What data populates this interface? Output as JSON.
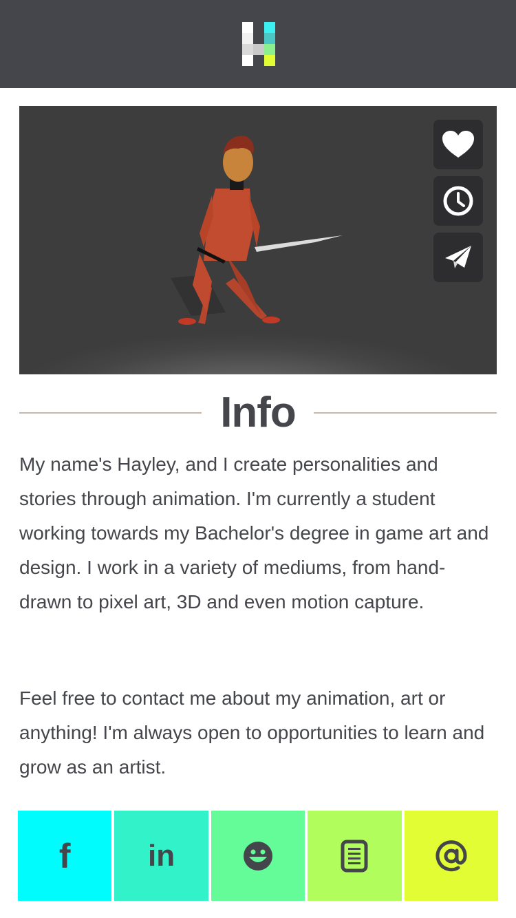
{
  "header": {
    "logo_icon": "pixel-h-logo-icon",
    "logo_colors": [
      "#ffffff",
      "#d9d9d9",
      "#3cf0f2",
      "#8cf08e",
      "#e2fd34"
    ]
  },
  "hero": {
    "image": "animated-character-with-sword",
    "actions": [
      {
        "icon": "heart-icon"
      },
      {
        "icon": "clock-icon"
      },
      {
        "icon": "paper-plane-icon"
      }
    ]
  },
  "info": {
    "title": "Info",
    "paragraph1": "My name's Hayley, and I create personalities and stories through animation. I'm currently a student working towards my Bachelor's degree in game art and design. I work in a variety of mediums, from hand-drawn to pixel art, 3D and even motion capture.",
    "paragraph2": "Feel free to contact me about my animation, art or anything! I'm always open to opportunities to learn and grow as an artist."
  },
  "social": {
    "facebook_glyph": "f",
    "linkedin_glyph": "in",
    "items": [
      {
        "icon": "facebook-icon",
        "color": "#00fcfd"
      },
      {
        "icon": "linkedin-icon",
        "color": "#31f2c9"
      },
      {
        "icon": "smiley-icon",
        "color": "#63fc98"
      },
      {
        "icon": "document-icon",
        "color": "#b0fd5c"
      },
      {
        "icon": "at-sign-icon",
        "color": "#e2fd34"
      }
    ]
  },
  "colors": {
    "header_bg": "#45464b",
    "text": "#45464b",
    "rule": "#c8b8ab",
    "action_bg": "#2d2d2f"
  }
}
